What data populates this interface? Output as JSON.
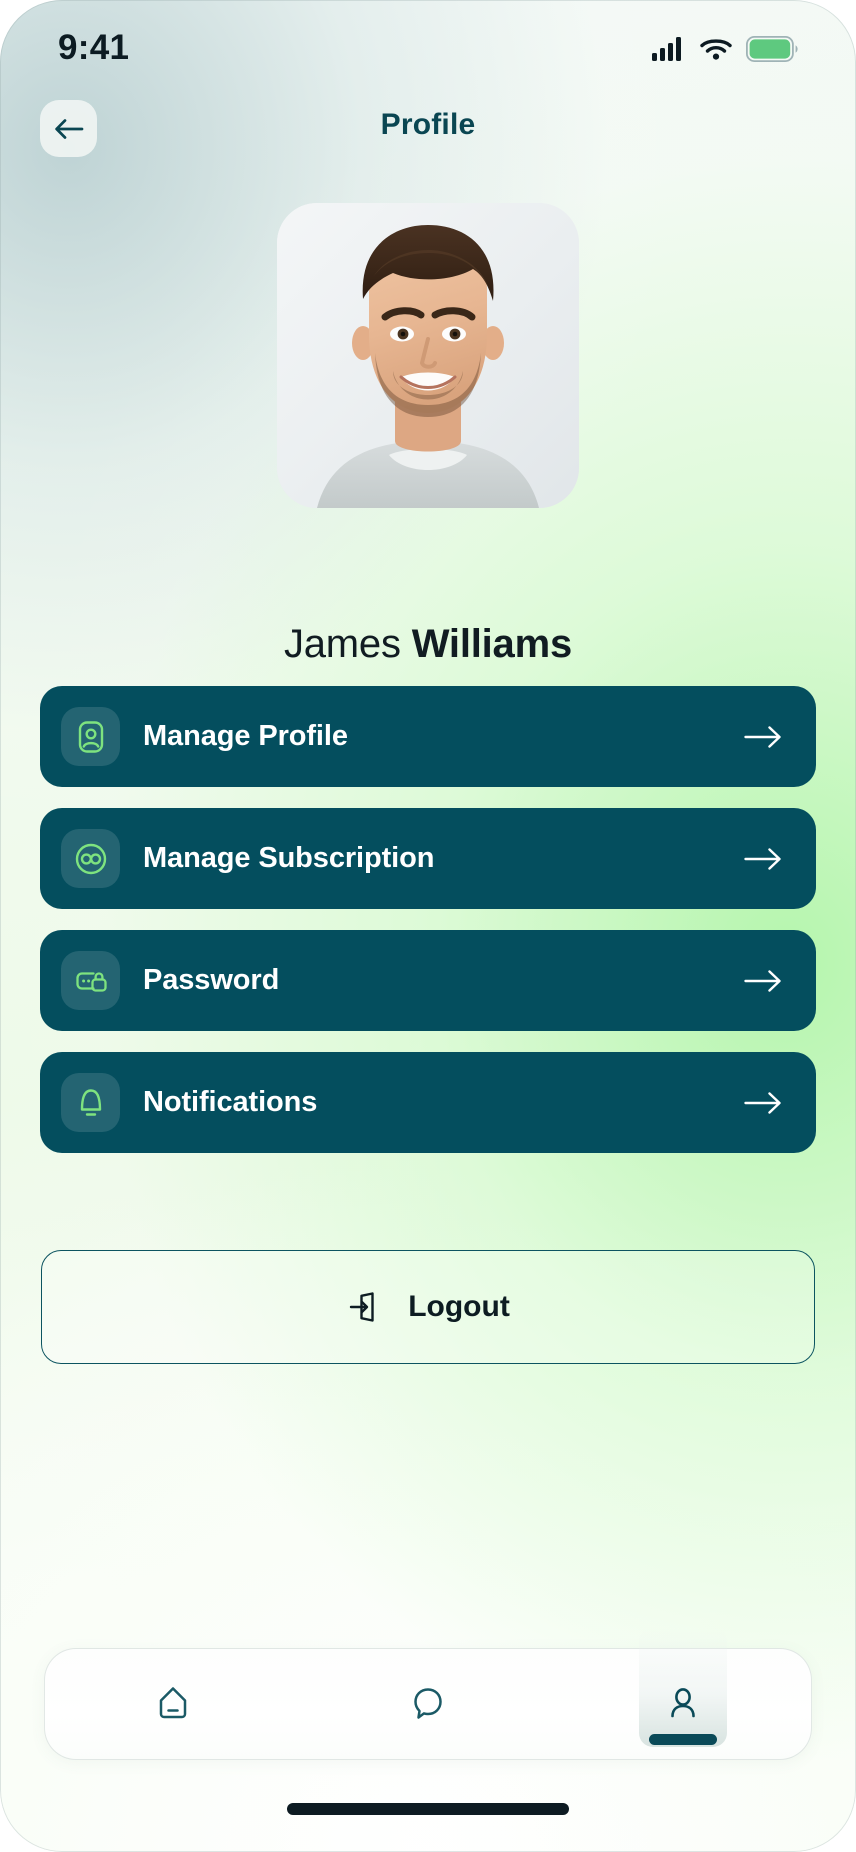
{
  "status_bar": {
    "time": "9:41",
    "icons": [
      "cellular-signal-icon",
      "wifi-icon",
      "battery-icon"
    ],
    "battery_color": "#5ec97f"
  },
  "header": {
    "title": "Profile",
    "back_icon": "arrow-left-icon",
    "title_color": "#0a4652"
  },
  "profile": {
    "avatar_alt": "user-photo",
    "first_name": "James",
    "last_name": "Williams"
  },
  "menu": {
    "items": [
      {
        "label": "Manage Profile",
        "icon": "user-card-icon",
        "arrow": "arrow-right-icon"
      },
      {
        "label": "Manage Subscription",
        "icon": "infinity-icon",
        "arrow": "arrow-right-icon"
      },
      {
        "label": "Password",
        "icon": "password-lock-icon",
        "arrow": "arrow-right-icon"
      },
      {
        "label": "Notifications",
        "icon": "bell-icon",
        "arrow": "arrow-right-icon"
      }
    ],
    "item_bg": "#044e5e",
    "icon_color": "#7ee37f",
    "label_color": "#ffffff"
  },
  "logout": {
    "label": "Logout",
    "icon": "logout-arrow-icon",
    "border_color": "#0c5460"
  },
  "tabbar": {
    "tabs": [
      {
        "name": "home",
        "icon": "home-icon",
        "active": false
      },
      {
        "name": "chat",
        "icon": "chat-bubble-icon",
        "active": false
      },
      {
        "name": "profile",
        "icon": "person-icon",
        "active": true
      }
    ],
    "active_indicator_color": "#0a4a58"
  }
}
